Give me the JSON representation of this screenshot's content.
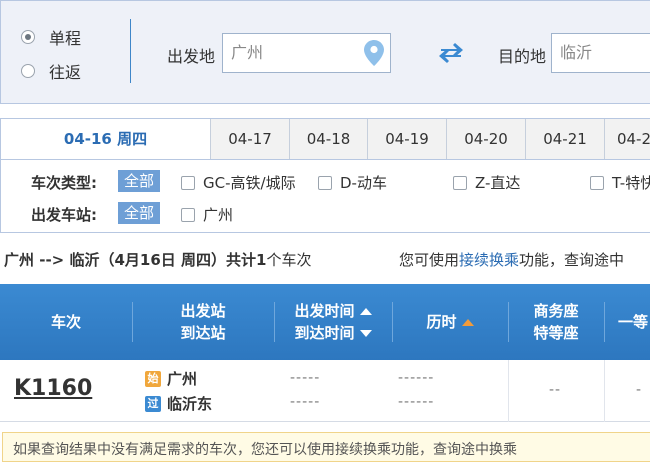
{
  "trip_type": {
    "one_way": "单程",
    "round_trip": "往返",
    "selected": "one_way"
  },
  "from": {
    "label": "出发地",
    "value": "广州"
  },
  "to": {
    "label": "目的地",
    "value": "临沂"
  },
  "icons": {
    "pin": "location-pin-icon",
    "swap": "swap-arrows-icon"
  },
  "date_tabs": [
    {
      "label": "04-16 周四",
      "active": true
    },
    {
      "label": "04-17"
    },
    {
      "label": "04-18"
    },
    {
      "label": "04-19"
    },
    {
      "label": "04-20"
    },
    {
      "label": "04-21"
    },
    {
      "label": "04-2"
    }
  ],
  "filters": {
    "type_label": "车次类型:",
    "station_label": "出发车站:",
    "all": "全部",
    "types": [
      "GC-高铁/城际",
      "D-动车",
      "Z-直达",
      "T-特快"
    ],
    "stations": [
      "广州"
    ]
  },
  "summary": {
    "prefix": "广州 --> 临沂（4月",
    "day": "16",
    "middle": "日  周四）共计",
    "count": "1",
    "suffix": "个车次"
  },
  "tip": {
    "before": "您可使用",
    "link": "接续换乘",
    "after": "功能，查询途中"
  },
  "table": {
    "col_train": "车次",
    "col_station_1": "出发站",
    "col_station_2": "到达站",
    "col_time_1": "出发时间",
    "col_time_2": "到达时间",
    "col_duration": "历时",
    "col_business_1": "商务座",
    "col_business_2": "特等座",
    "col_first": "一等"
  },
  "rows": [
    {
      "train": "K1160",
      "from_badge": "始",
      "from_station": "广州",
      "to_badge": "过",
      "to_station": "临沂东",
      "depart": "-----",
      "arrive": "-----",
      "dur1": "------",
      "dur2": "------",
      "business": "--",
      "first": "-"
    }
  ],
  "notice": "如果查询结果中没有满足需求的车次，您还可以使用接续换乘功能，查询途中换乘"
}
